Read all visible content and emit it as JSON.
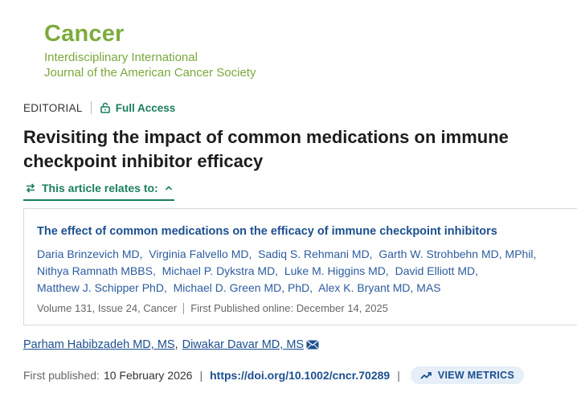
{
  "journal": {
    "name": "Cancer",
    "subtitle_line1": "Interdisciplinary International",
    "subtitle_line2": "Journal of the American Cancer Society",
    "brand_color": "#7dab3c"
  },
  "article": {
    "type": "EDITORIAL",
    "access": "Full Access",
    "title": "Revisiting the impact of common medications on immune checkpoint inhibitor efficacy"
  },
  "relates": {
    "label": "This article relates to:",
    "icon": "swap-icon",
    "toggle_icon": "chevron-up-icon"
  },
  "related_article": {
    "title": "The effect of common medications on the efficacy of immune checkpoint inhibitors",
    "authors": [
      "Daria Brinzevich MD,",
      "Virginia Falvello MD,",
      "Sadiq S. Rehmani MD,",
      "Garth W. Strohbehn MD, MPhil,",
      "Nithya Ramnath MBBS,",
      "Michael P. Dykstra MD,",
      "Luke M. Higgins MD,",
      "David Elliott MD,",
      "Matthew J. Schipper PhD,",
      "Michael D. Green MD, PhD,",
      "Alex K. Bryant MD, MAS"
    ],
    "volume": "Volume 131",
    "issue": "Issue 24",
    "journal": "Cancer",
    "first_published_label": "First Published online:",
    "first_published_date": "December 14, 2025"
  },
  "byline": {
    "authors": [
      "Parham Habibzadeh MD, MS",
      "Diwakar Davar MD, MS"
    ],
    "separator": ",",
    "contact_icon": "envelope-icon"
  },
  "publication": {
    "label": "First published:",
    "date": "10 February 2026",
    "doi": "https://doi.org/10.1002/cncr.70289",
    "metrics_label": "VIEW METRICS",
    "metrics_icon": "trending-up-icon"
  },
  "colors": {
    "accent_green": "#1a7f5a",
    "link_blue": "#1c4f8f"
  }
}
